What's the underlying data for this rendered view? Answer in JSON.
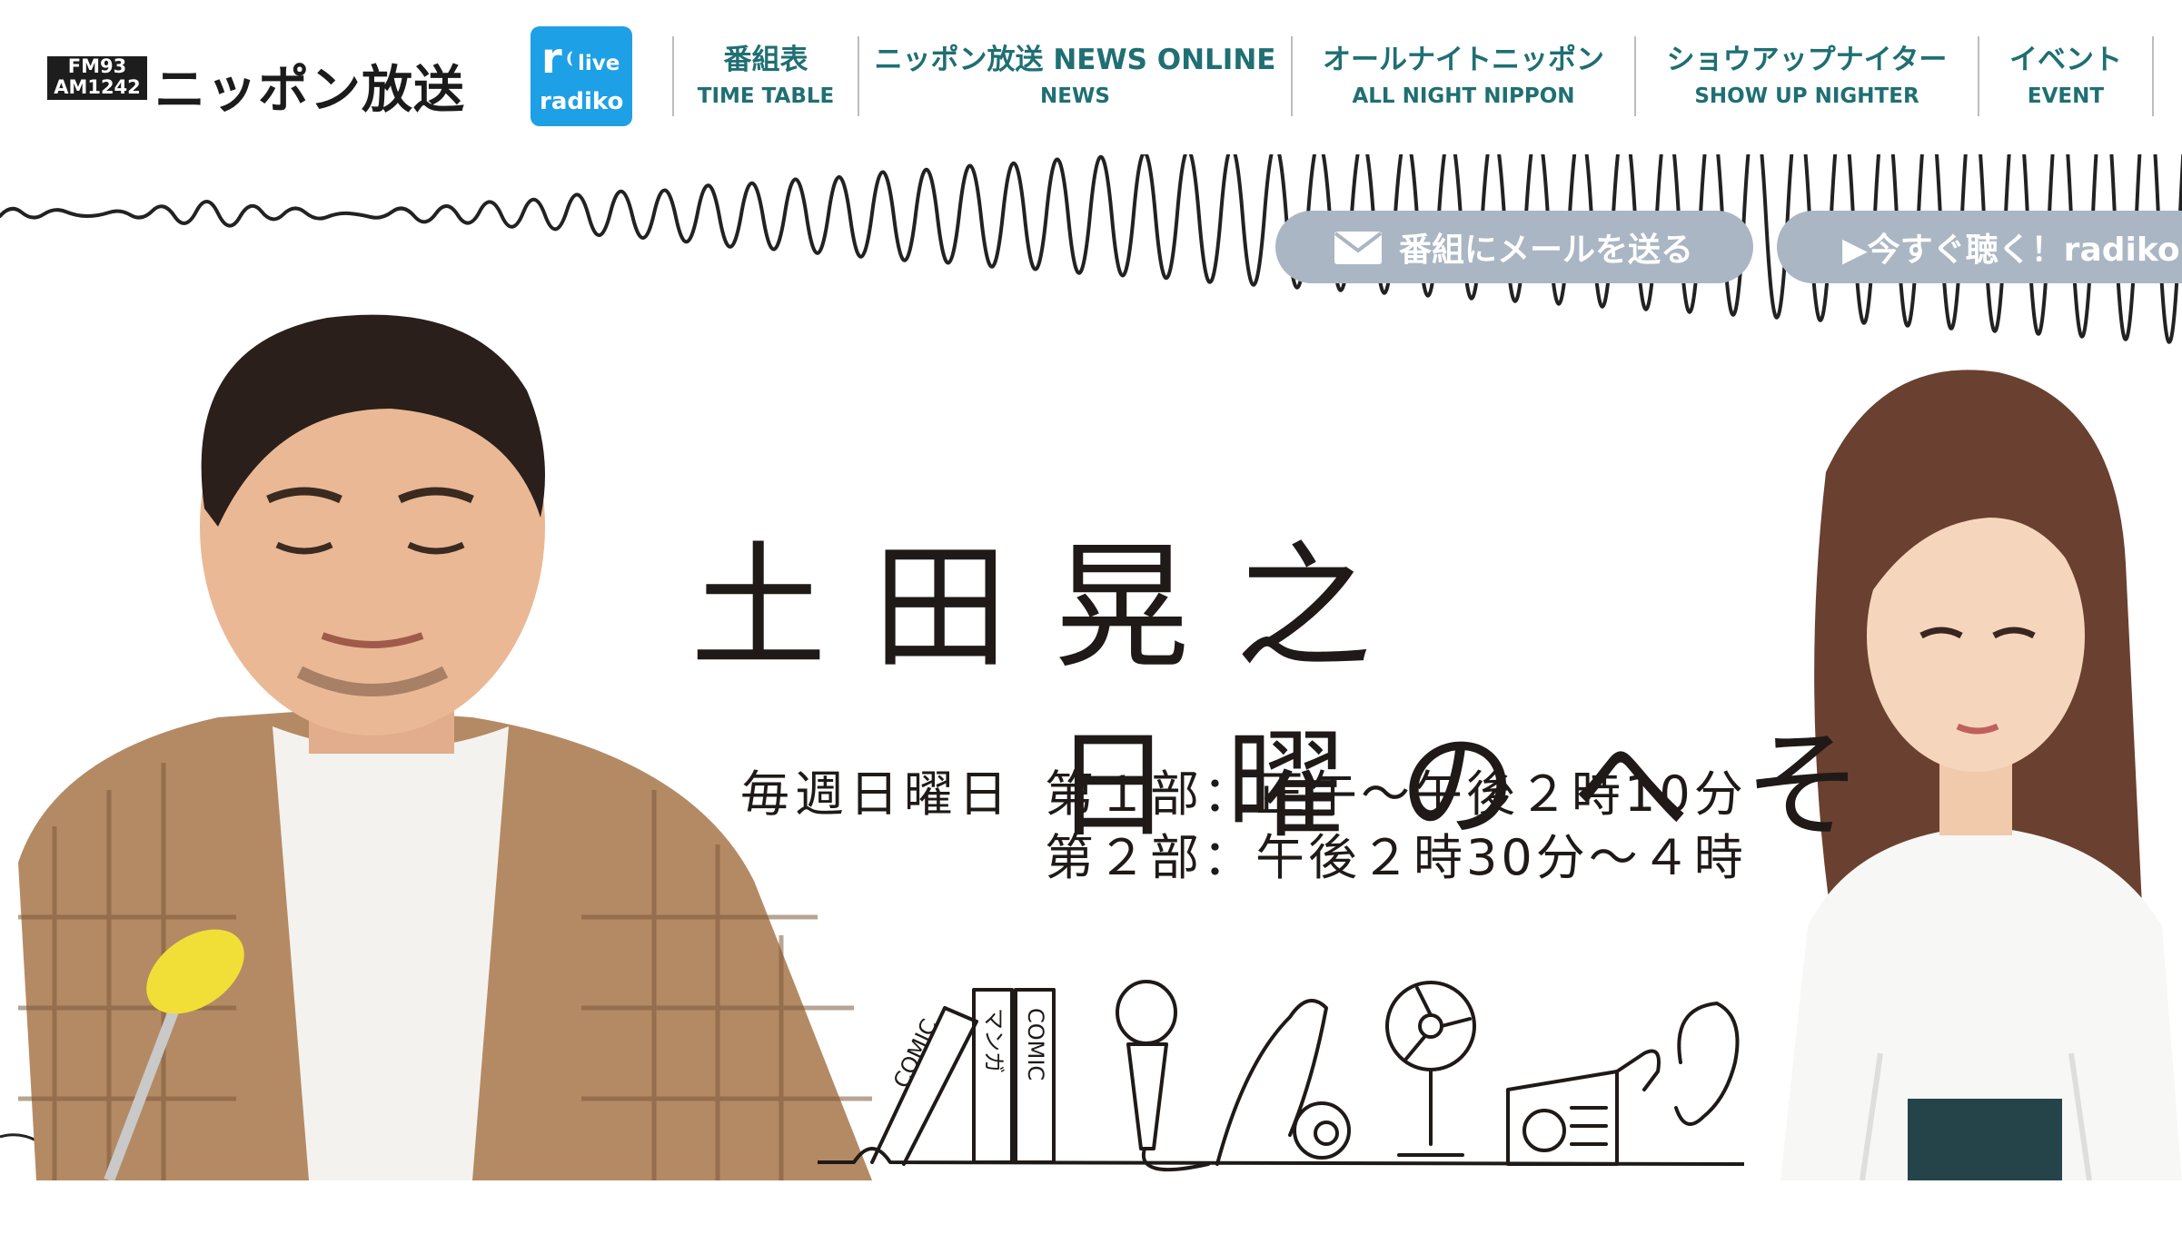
{
  "header": {
    "logo": {
      "freq_top": "FM93",
      "freq_bottom": "AM1242",
      "station_name": "ニッポン放送"
    },
    "radiko": {
      "r": "r",
      "live": "live",
      "word": "radiko"
    },
    "nav": [
      {
        "jp": "番組表",
        "en": "TIME TABLE"
      },
      {
        "jp": "ニッポン放送 NEWS ONLINE",
        "en": "NEWS"
      },
      {
        "jp": "オールナイトニッポン",
        "en": "ALL NIGHT NIPPON"
      },
      {
        "jp": "ショウアップナイター",
        "en": "SHOW UP NIGHTER"
      },
      {
        "jp": "イベント",
        "en": "EVENT"
      }
    ]
  },
  "hero": {
    "buttons": {
      "mail": "番組にメールを送る",
      "listen": "▶今すぐ聴く！radiko"
    },
    "title_line1": "土田晃之",
    "title_line2": "日曜のへそ",
    "schedule": {
      "days": "毎週日曜日",
      "part1": "第１部：正午〜午後２時10分",
      "part2": "第２部：午後２時30分〜４時"
    },
    "doodles": {
      "comic_1": "COMIC",
      "manga": "マンガ",
      "comic_2": "COMIC"
    }
  },
  "colors": {
    "nav_text": "#1f6f73",
    "radiko_blue": "#1ea0e6",
    "pill_gray": "#aab6c3"
  }
}
